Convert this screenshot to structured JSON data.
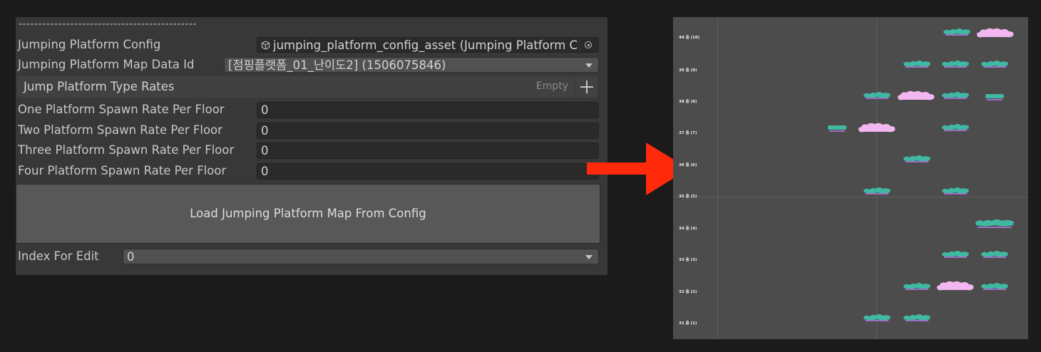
{
  "inspector": {
    "separator": "---------------------------------------------",
    "config_label": "Jumping Platform Config",
    "config_value": "jumping_platform_config_asset (Jumping Platform C",
    "map_data_label": "Jumping Platform Map Data Id",
    "map_data_value": "[점핑플랫폼_01_난이도2] (1506075846)",
    "type_rates_label": "Jump Platform Type Rates",
    "type_rates_empty": "Empty",
    "spawn_rates": [
      {
        "label": "One Platform Spawn Rate Per Floor",
        "value": "0"
      },
      {
        "label": "Two Platform Spawn Rate Per Floor",
        "value": "0"
      },
      {
        "label": "Three Platform Spawn Rate Per Floor",
        "value": "0"
      },
      {
        "label": "Four Platform Spawn Rate Per Floor",
        "value": "0"
      }
    ],
    "load_button": "Load Jumping Platform Map From Config",
    "index_label": "Index For Edit",
    "index_value": "0"
  },
  "map_preview": {
    "floors": [
      {
        "label": "40 층 (10)"
      },
      {
        "label": "39 층 (9)"
      },
      {
        "label": "38 층 (8)"
      },
      {
        "label": "37 층 (7)"
      },
      {
        "label": "36 층 (6)"
      },
      {
        "label": "35 층 (5)"
      },
      {
        "label": "34 층 (4)"
      },
      {
        "label": "33 층 (3)"
      },
      {
        "label": "32 층 (2)"
      },
      {
        "label": "31 층 (1)"
      }
    ],
    "colors": {
      "platform_green": "#3fb9a2",
      "platform_cloud": "#f2b6f0",
      "arrow": "#ff2a0c"
    }
  }
}
